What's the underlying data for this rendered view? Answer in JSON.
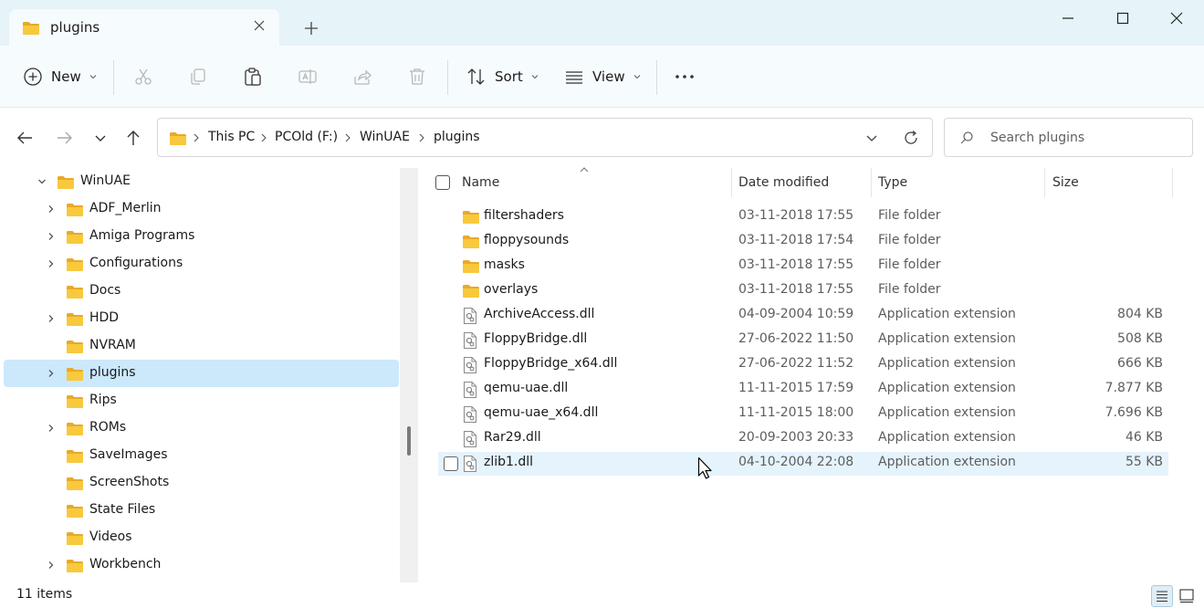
{
  "window": {
    "tab_title": "plugins",
    "colors": {
      "titlebar": "#e6f3f8",
      "selection": "#cce8fb",
      "hover": "#e5f3fd",
      "folder": "#f8c93c"
    }
  },
  "toolbar": {
    "new_label": "New",
    "sort_label": "Sort",
    "view_label": "View",
    "icons": [
      "plus-circle-icon",
      "cut-icon",
      "copy-icon",
      "paste-icon",
      "rename-icon",
      "share-icon",
      "delete-icon",
      "sort-icon",
      "view-icon",
      "more-icon"
    ]
  },
  "address": {
    "crumbs": [
      "This PC",
      "PCOld (F:)",
      "WinUAE",
      "plugins"
    ]
  },
  "search": {
    "placeholder": "Search plugins"
  },
  "sidebar": {
    "items": [
      {
        "label": "WinUAE",
        "level": 0,
        "expander": "expanded",
        "selected": false
      },
      {
        "label": "ADF_Merlin",
        "level": 1,
        "expander": "collapsed",
        "selected": false
      },
      {
        "label": "Amiga Programs",
        "level": 1,
        "expander": "collapsed",
        "selected": false
      },
      {
        "label": "Configurations",
        "level": 1,
        "expander": "collapsed",
        "selected": false
      },
      {
        "label": "Docs",
        "level": 1,
        "expander": "none",
        "selected": false
      },
      {
        "label": "HDD",
        "level": 1,
        "expander": "collapsed",
        "selected": false
      },
      {
        "label": "NVRAM",
        "level": 1,
        "expander": "none",
        "selected": false
      },
      {
        "label": "plugins",
        "level": 1,
        "expander": "collapsed",
        "selected": true
      },
      {
        "label": "Rips",
        "level": 1,
        "expander": "none",
        "selected": false
      },
      {
        "label": "ROMs",
        "level": 1,
        "expander": "collapsed",
        "selected": false
      },
      {
        "label": "SaveImages",
        "level": 1,
        "expander": "none",
        "selected": false
      },
      {
        "label": "ScreenShots",
        "level": 1,
        "expander": "none",
        "selected": false
      },
      {
        "label": "State Files",
        "level": 1,
        "expander": "none",
        "selected": false
      },
      {
        "label": "Videos",
        "level": 1,
        "expander": "none",
        "selected": false
      },
      {
        "label": "Workbench",
        "level": 1,
        "expander": "collapsed",
        "selected": false
      }
    ]
  },
  "filelist": {
    "columns": {
      "name": "Name",
      "date": "Date modified",
      "type": "Type",
      "size": "Size"
    },
    "rows": [
      {
        "name": "filtershaders",
        "date": "03-11-2018 17:55",
        "type": "File folder",
        "size": "",
        "kind": "folder"
      },
      {
        "name": "floppysounds",
        "date": "03-11-2018 17:54",
        "type": "File folder",
        "size": "",
        "kind": "folder"
      },
      {
        "name": "masks",
        "date": "03-11-2018 17:55",
        "type": "File folder",
        "size": "",
        "kind": "folder"
      },
      {
        "name": "overlays",
        "date": "03-11-2018 17:55",
        "type": "File folder",
        "size": "",
        "kind": "folder"
      },
      {
        "name": "ArchiveAccess.dll",
        "date": "04-09-2004 10:59",
        "type": "Application extension",
        "size": "804 KB",
        "kind": "dll"
      },
      {
        "name": "FloppyBridge.dll",
        "date": "27-06-2022 11:50",
        "type": "Application extension",
        "size": "508 KB",
        "kind": "dll"
      },
      {
        "name": "FloppyBridge_x64.dll",
        "date": "27-06-2022 11:52",
        "type": "Application extension",
        "size": "666 KB",
        "kind": "dll"
      },
      {
        "name": "qemu-uae.dll",
        "date": "11-11-2015 17:59",
        "type": "Application extension",
        "size": "7.877 KB",
        "kind": "dll"
      },
      {
        "name": "qemu-uae_x64.dll",
        "date": "11-11-2015 18:00",
        "type": "Application extension",
        "size": "7.696 KB",
        "kind": "dll"
      },
      {
        "name": "Rar29.dll",
        "date": "20-09-2003 20:33",
        "type": "Application extension",
        "size": "46 KB",
        "kind": "dll"
      },
      {
        "name": "zlib1.dll",
        "date": "04-10-2004 22:08",
        "type": "Application extension",
        "size": "55 KB",
        "kind": "dll",
        "hover": true
      }
    ]
  },
  "status": {
    "item_count": "11 items"
  }
}
